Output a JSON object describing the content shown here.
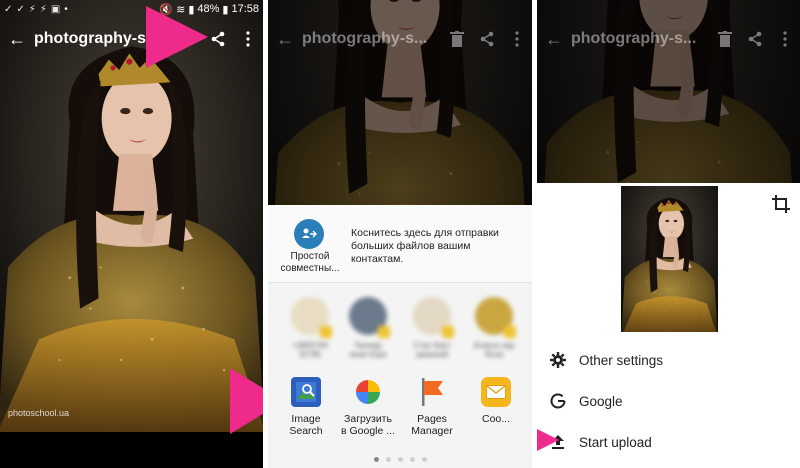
{
  "status_bar": {
    "battery": "48%",
    "time": "17:58"
  },
  "panel1": {
    "title": "photography-s",
    "watermark": "photoschool.ua"
  },
  "panel2": {
    "title": "photography-s...",
    "direct_share": {
      "label": "Простой совместны...",
      "hint": "Коснитесь здесь для отправки больших файлов вашим контактам."
    },
    "blurred_contacts": [
      {
        "label": "+3800794 32785"
      },
      {
        "label": "Чепиар иная Юра"
      },
      {
        "label": "Стас Кант умжений"
      },
      {
        "label": "Алексе кар Ясна"
      }
    ],
    "apps": [
      {
        "label": "Image\nSearch",
        "icon": "image-search-icon"
      },
      {
        "label": "Загрузить\nв Google ...",
        "icon": "google-photos-icon"
      },
      {
        "label": "Pages\nManager",
        "icon": "pages-manager-icon"
      },
      {
        "label": "Coo...",
        "icon": "email-icon"
      }
    ]
  },
  "panel3": {
    "title": "photography-s...",
    "menu": [
      {
        "label": "Other settings",
        "icon": "gear-icon"
      },
      {
        "label": "Google",
        "icon": "google-icon"
      },
      {
        "label": "Start upload",
        "icon": "upload-icon"
      }
    ]
  },
  "colors": {
    "highlight_arrow": "#ee2a8a",
    "share_blue": "#2a7fb8"
  }
}
